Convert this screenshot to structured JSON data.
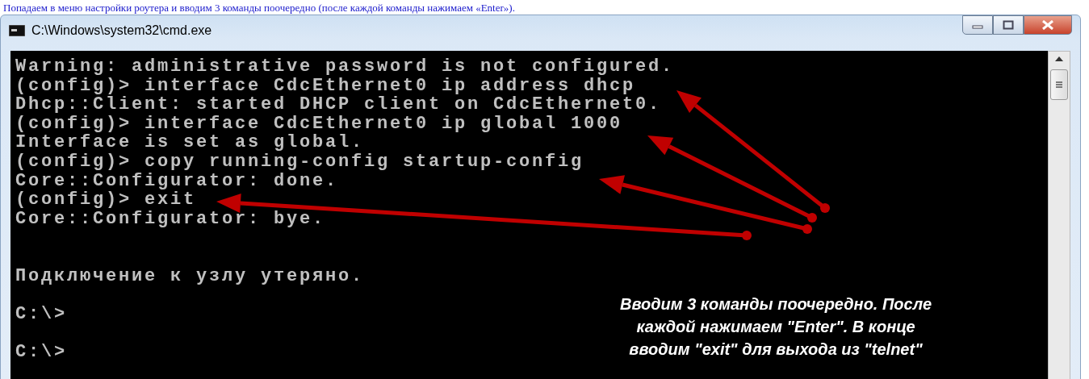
{
  "caption": "Попадаем в меню настройки роутера и вводим 3 команды поочередно (после каждой команды нажимаем «Enter»).",
  "window": {
    "title": "C:\\Windows\\system32\\cmd.exe"
  },
  "console": {
    "blocks": [
      [
        "Warning: administrative password is not configured.",
        "(config)> interface CdcEthernet0 ip address dhcp",
        "Dhcp::Client: started DHCP client on CdcEthernet0.",
        "(config)> interface CdcEthernet0 ip global 1000",
        "Interface is set as global.",
        "(config)> copy running-config startup-config",
        "Core::Configurator: done.",
        "(config)> exit",
        "Core::Configurator: bye."
      ],
      [
        "Подключение к узлу утеряно."
      ],
      [
        "C:\\>"
      ],
      [
        "C:\\>"
      ]
    ]
  },
  "annotation": {
    "lines": [
      "Вводим 3 команды поочередно. После",
      "каждой нажимаем \"Enter\". В конце",
      "вводим \"exit\" для выхода из \"telnet\""
    ]
  }
}
